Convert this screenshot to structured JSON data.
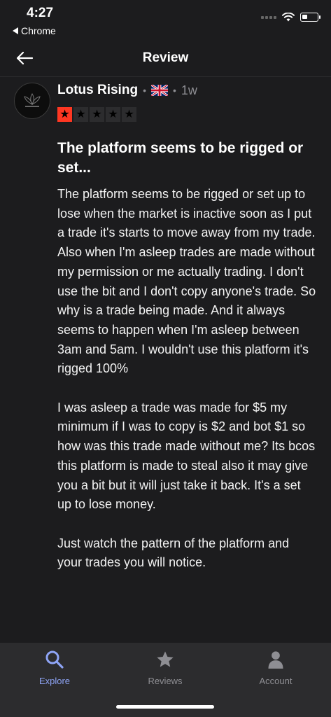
{
  "status_bar": {
    "time": "4:27",
    "back_app": "Chrome"
  },
  "header": {
    "title": "Review",
    "back_icon": "arrow-left-icon"
  },
  "review": {
    "reviewer_name": "Lotus Rising",
    "country_flag": "uk-flag-icon",
    "age": "1w",
    "rating": 1,
    "rating_max": 5,
    "star_color": "#ff3722",
    "title": "The platform seems to be rigged or set...",
    "body": [
      "The platform seems to be rigged or set up to lose  when the market is inactive soon as I put a trade it's starts to move away from my trade. Also when I'm asleep trades are made without my permission or me actually trading. I don't use the bit and I don't copy anyone's trade. So why is a trade being made. And it always seems to happen  when I'm asleep between 3am and 5am. I wouldn't use this platform it's rigged 100%",
      "I was asleep a trade was made for $5 my minimum if I was to copy is $2 and bot $1 so how was this trade made without me? Its bcos this platform is made to steal also it may give you a bit but it will just take it back. It's a set up to lose money.",
      "Just watch the pattern of the platform and your trades you will notice."
    ]
  },
  "tabbar": {
    "accent_color": "#8ea4f5",
    "items": [
      {
        "label": "Explore",
        "icon": "search-icon",
        "active": true
      },
      {
        "label": "Reviews",
        "icon": "star-icon",
        "active": false
      },
      {
        "label": "Account",
        "icon": "person-icon",
        "active": false
      }
    ]
  }
}
